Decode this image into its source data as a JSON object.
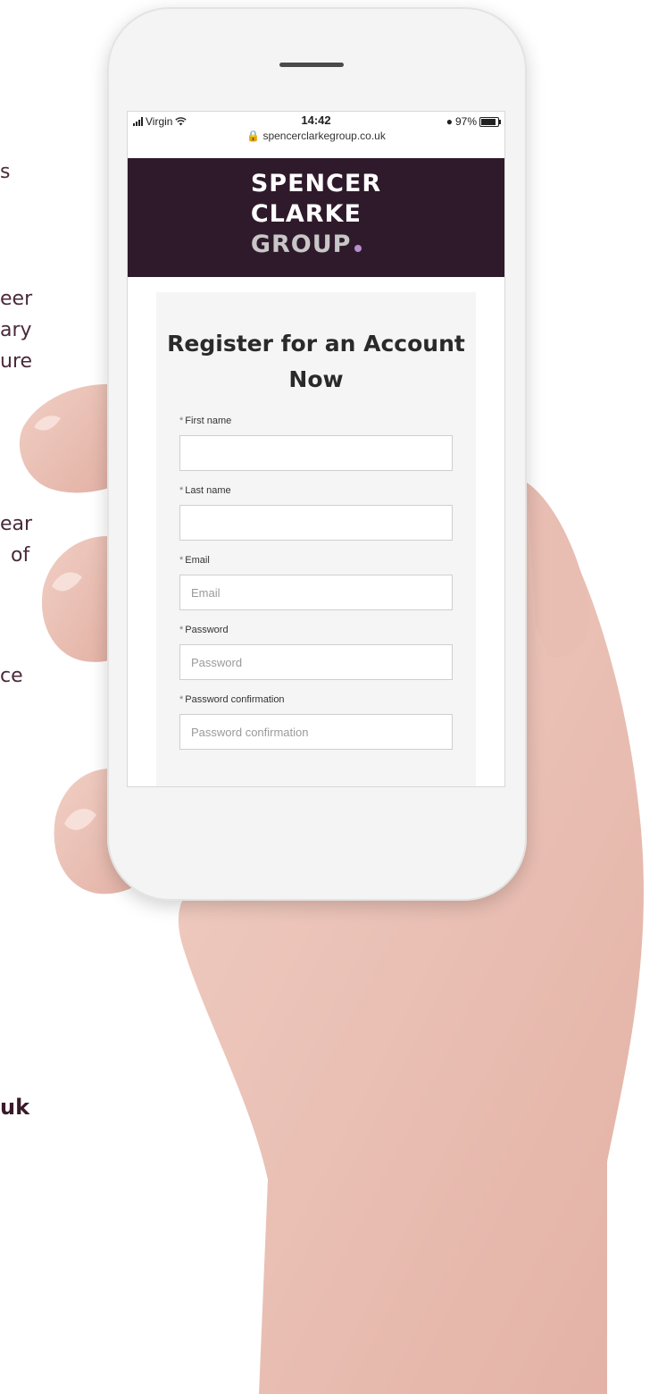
{
  "background": {
    "fragments": [
      {
        "text": "s",
        "left": 0,
        "top": 0
      },
      {
        "text": "eer"
      },
      {
        "text": "ary"
      },
      {
        "text": "ure"
      },
      {
        "text": "ear"
      },
      {
        "text": "of"
      },
      {
        "text": "ce"
      },
      {
        "text": "uk"
      }
    ]
  },
  "status_bar": {
    "carrier": "Virgin",
    "time": "14:42",
    "url": "spencerclarkegroup.co.uk",
    "battery": "97%"
  },
  "header": {
    "logo_line1": "SPENCER",
    "logo_line2": "CLARKE",
    "logo_line3": "GROUP",
    "colors": {
      "bar": "#2f1a2b",
      "dot": "#b98bd1"
    }
  },
  "form": {
    "title": "Register for an Account Now",
    "required_mark": "*",
    "fields": [
      {
        "label": "First name",
        "value": "",
        "placeholder": ""
      },
      {
        "label": "Last name",
        "value": "",
        "placeholder": ""
      },
      {
        "label": "Email",
        "value": "",
        "placeholder": "Email"
      },
      {
        "label": "Password",
        "value": "",
        "placeholder": "Password"
      },
      {
        "label": "Password confirmation",
        "value": "",
        "placeholder": "Password confirmation"
      }
    ]
  }
}
